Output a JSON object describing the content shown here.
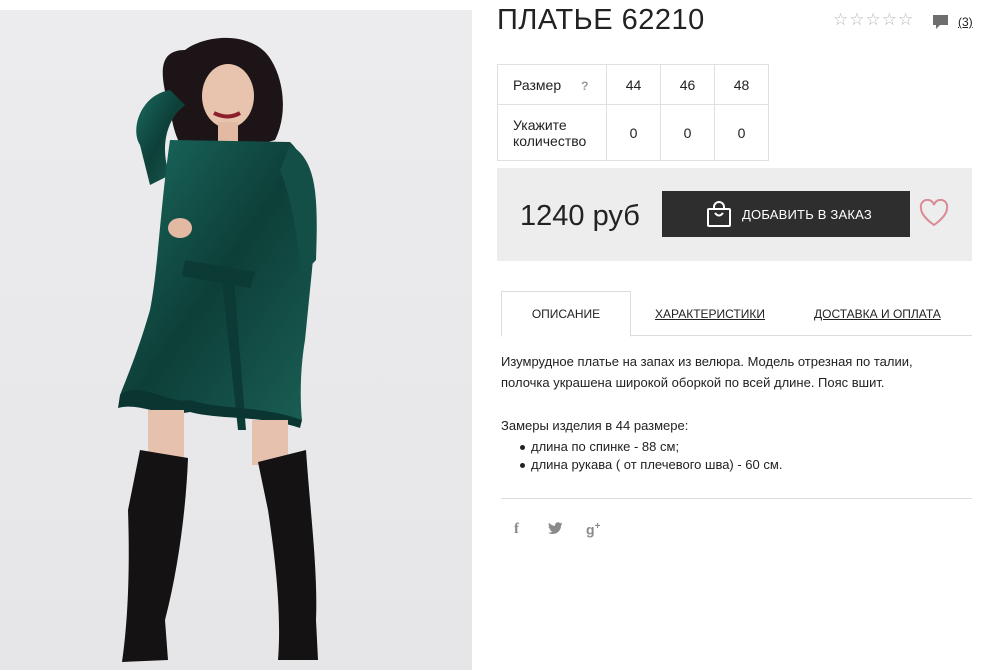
{
  "product": {
    "title": "ПЛАТЬЕ 62210",
    "rating_stars": 5,
    "rating_value": 0,
    "review_count": "(3)"
  },
  "sizes": {
    "size_label": "Размер",
    "help_symbol": "?",
    "qty_label_line1": "Укажите",
    "qty_label_line2": "количество",
    "items": [
      {
        "size": "44",
        "qty": "0"
      },
      {
        "size": "46",
        "qty": "0"
      },
      {
        "size": "48",
        "qty": "0"
      }
    ]
  },
  "purchase": {
    "price": "1240 руб",
    "add_to_cart_label": "ДОБАВИТЬ В ЗАКАЗ"
  },
  "tabs": [
    {
      "label": "ОПИСАНИЕ",
      "active": true
    },
    {
      "label": "ХАРАКТЕРИСТИКИ",
      "active": false
    },
    {
      "label": "ДОСТАВКА И ОПЛАТА",
      "active": false
    }
  ],
  "description": {
    "line1": "Изумрудное платье на запах из велюра. Модель отрезная по талии,",
    "line2": "полочка украшена широкой оборкой по всей длине. Пояс вшит.",
    "measures_title": "Замеры изделия в 44 размере:",
    "measures": [
      "длина по спинке - 88 см;",
      "длина рукава ( от плечевого шва) - 60 см."
    ]
  },
  "social": {
    "facebook": "f",
    "twitter": "🐦",
    "gplus": "g",
    "gplus_sup": "+"
  },
  "colors": {
    "dress": "#0f4a42",
    "button": "#2e2e2e",
    "heart": "#d98b96",
    "price_box": "#ededed"
  },
  "icons": [
    "star-icon",
    "comment-icon",
    "shopping-bag-icon",
    "heart-icon",
    "facebook-icon",
    "twitter-icon",
    "google-plus-icon"
  ]
}
